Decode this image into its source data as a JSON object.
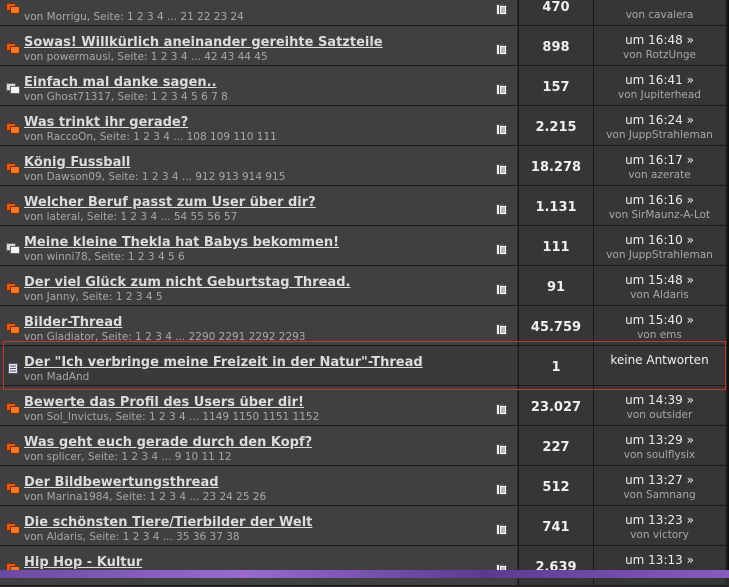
{
  "threads": [
    {
      "type": "hot",
      "title": "",
      "meta": "von Morrigu, Seite: 1 2 3 4 ... 21 22 23 24",
      "replies": "470",
      "time": "",
      "user": "von cavalera"
    },
    {
      "type": "hot",
      "title": "Sowas! Willkürlich aneinander gereihte Satzteile",
      "meta": "von powermausi, Seite: 1 2 3 4 ... 42 43 44 45",
      "replies": "898",
      "time": "um 16:48 »",
      "user": "von RotzUnge"
    },
    {
      "type": "normal",
      "title": "Einfach mal danke sagen..",
      "meta": "von Ghost71317, Seite: 1 2 3 4 5 6 7 8",
      "replies": "157",
      "time": "um 16:41 »",
      "user": "von Jupiterhead"
    },
    {
      "type": "hot",
      "title": "Was trinkt ihr gerade?",
      "meta": "von RaccoOn, Seite: 1 2 3 4 ... 108 109 110 111",
      "replies": "2.215",
      "time": "um 16:24 »",
      "user": "von JuppStrahleman"
    },
    {
      "type": "hot",
      "title": "König Fussball",
      "meta": "von Dawson09, Seite: 1 2 3 4 ... 912 913 914 915",
      "replies": "18.278",
      "time": "um 16:17 »",
      "user": "von azerate"
    },
    {
      "type": "hot",
      "title": "Welcher Beruf passt zum User über dir?",
      "meta": "von lateral, Seite: 1 2 3 4 ... 54 55 56 57",
      "replies": "1.131",
      "time": "um 16:16 »",
      "user": "von SirMaunz-A-Lot"
    },
    {
      "type": "normal",
      "title": "Meine kleine Thekla hat Babys bekommen!",
      "meta": "von winni78, Seite: 1 2 3 4 5 6",
      "replies": "111",
      "time": "um 16:10 »",
      "user": "von JuppStrahleman"
    },
    {
      "type": "hot",
      "title": "Der viel Glück zum nicht Geburtstag Thread.",
      "meta": "von Janny, Seite: 1 2 3 4 5",
      "replies": "91",
      "time": "um 15:48 »",
      "user": "von Aldaris"
    },
    {
      "type": "hot",
      "title": "Bilder-Thread",
      "meta": "von Gladiator, Seite: 1 2 3 4 ... 2290 2291 2292 2293",
      "replies": "45.759",
      "time": "um 15:40 »",
      "user": "von ems"
    },
    {
      "type": "new",
      "title": "Der \"Ich verbringe meine Freizeit in der Natur\"-Thread",
      "meta": "von MadAnd",
      "replies": "1",
      "time": "keine Antworten",
      "user": ""
    },
    {
      "type": "hot",
      "title": "Bewerte das Profil des Users über dir!",
      "meta": "von Sol_Invictus, Seite: 1 2 3 4 ... 1149 1150 1151 1152",
      "replies": "23.027",
      "time": "um 14:39 »",
      "user": "von outsider"
    },
    {
      "type": "hot",
      "title": "Was geht euch gerade durch den Kopf?",
      "meta": "von splicer, Seite: 1 2 3 4 ... 9 10 11 12",
      "replies": "227",
      "time": "um 13:29 »",
      "user": "von soulflysix"
    },
    {
      "type": "hot",
      "title": "Der Bildbewertungsthread",
      "meta": "von Marina1984, Seite: 1 2 3 4 ... 23 24 25 26",
      "replies": "512",
      "time": "um 13:27 »",
      "user": "von Samnang"
    },
    {
      "type": "hot",
      "title": "Die schönsten Tiere/Tierbilder der Welt",
      "meta": "von Aldaris, Seite: 1 2 3 4 ... 35 36 37 38",
      "replies": "741",
      "time": "um 13:23 »",
      "user": "von victory"
    },
    {
      "type": "hot",
      "title": "Hip Hop - Kultur",
      "meta": "",
      "replies": "2.639",
      "time": "um 13:13 »",
      "user": ""
    }
  ]
}
